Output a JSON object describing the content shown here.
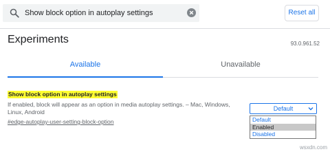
{
  "search": {
    "value": "Show block option in autoplay settings"
  },
  "toolbar": {
    "reset_label": "Reset all"
  },
  "page": {
    "title": "Experiments",
    "version": "93.0.961.52"
  },
  "tabs": [
    {
      "label": "Available",
      "selected": true
    },
    {
      "label": "Unavailable",
      "selected": false
    }
  ],
  "flag": {
    "title": "Show block option in autoplay settings",
    "description": "If enabled, block will appear as an option in media autoplay settings. – Mac, Windows, Linux, Android",
    "link": "#edge-autoplay-user-setting-block-option",
    "select_value": "Default",
    "options": [
      "Default",
      "Enabled",
      "Disabled"
    ],
    "highlighted_option": "Enabled"
  },
  "watermark": "wsxdn.com",
  "colors": {
    "accent": "#1a73e8",
    "highlight": "#ffff33",
    "option_hover": "#c8c8c8"
  },
  "icons": {
    "search": "search-icon",
    "clear": "clear-icon",
    "dropdown": "chevron-down-icon"
  }
}
